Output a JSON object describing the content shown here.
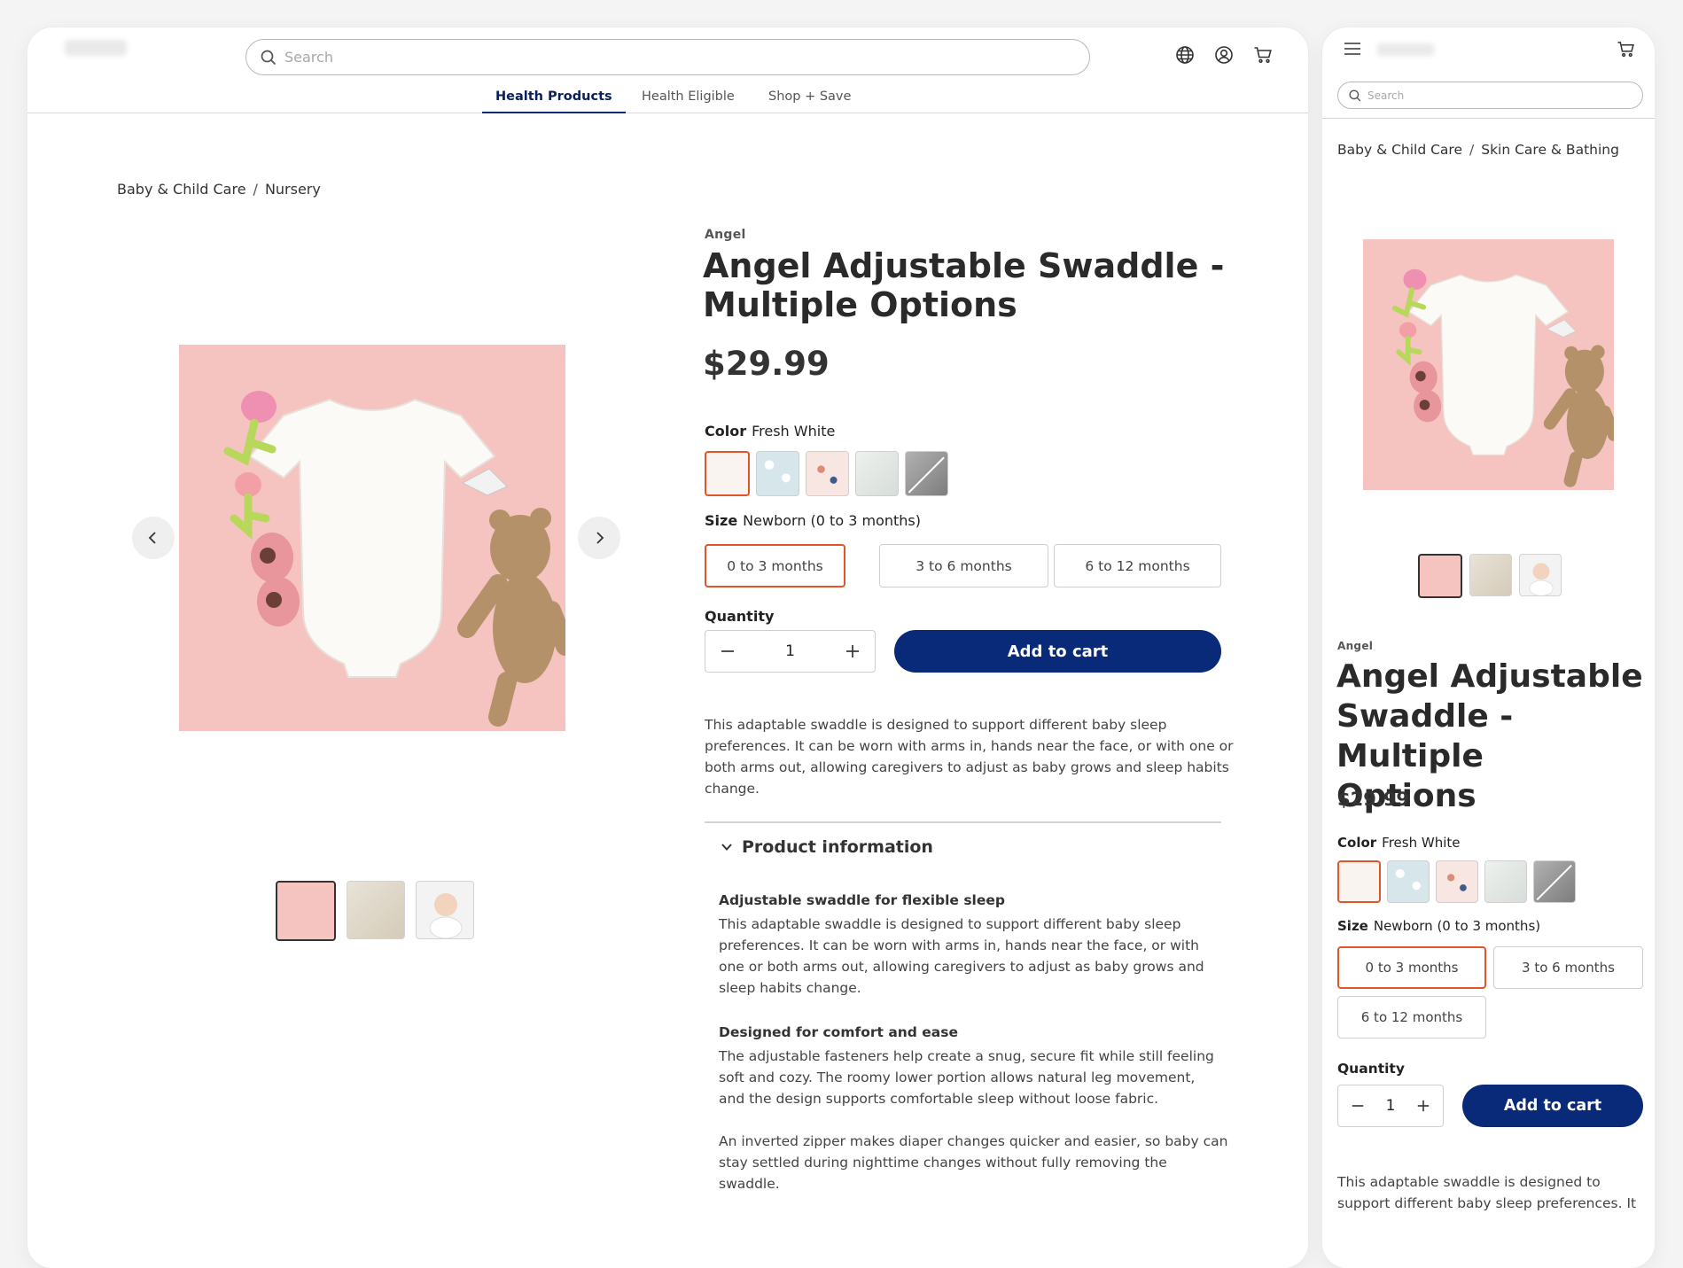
{
  "desktop": {
    "search_placeholder": "Search",
    "nav_tabs": [
      "Health Products",
      "Health Eligible",
      "Shop + Save"
    ],
    "breadcrumb": [
      "Baby & Child Care",
      "Nursery"
    ],
    "brand": "Angel",
    "title_line1": "Angel Adjustable Swaddle -",
    "title_line2": "Multiple Options",
    "price": "$29.99",
    "color_label": "Color",
    "color_value": "Fresh White",
    "size_label": "Size",
    "size_value": "Newborn (0 to 3 months)",
    "sizes": [
      "0 to 3 months",
      "3 to 6 months",
      "6 to 12 months"
    ],
    "quantity_label": "Quantity",
    "quantity": "1",
    "add_to_cart": "Add to cart",
    "description_lines": [
      "This adaptable swaddle is designed to support different baby sleep",
      "preferences. It can be worn with arms in, hands near the face, or with one or",
      "both arms out, allowing caregivers to adjust as baby grows and sleep habits",
      "change."
    ],
    "accordion_title": "Product information",
    "section1_heading": "Adjustable swaddle for flexible sleep",
    "section1_lines": [
      "This adaptable swaddle is designed to support different baby sleep",
      "preferences. It can be worn with arms in, hands near the face, or with",
      "one or both arms out, allowing caregivers to adjust as baby grows and",
      "sleep habits change."
    ],
    "section2_heading": "Designed for comfort and ease",
    "section2_lines": [
      "The adjustable fasteners help create a snug, secure fit while still feeling",
      "soft and cozy. The roomy lower portion allows natural leg movement,",
      "and the design supports comfortable sleep without loose fabric."
    ],
    "section3_lines": [
      "An inverted zipper makes diaper changes quicker and easier, so baby can",
      "stay settled during nighttime changes without fully removing the",
      "swaddle."
    ]
  },
  "mobile": {
    "search_placeholder": "Search",
    "breadcrumb": [
      "Baby & Child Care",
      "Skin Care & Bathing"
    ],
    "brand": "Angel",
    "title_line1": "Angel Adjustable",
    "title_line2": "Swaddle - Multiple",
    "title_line3": "Options",
    "price": "$29.99",
    "color_label": "Color",
    "color_value": "Fresh White",
    "size_label": "Size",
    "size_value": "Newborn (0 to 3 months)",
    "sizes": [
      "0 to 3 months",
      "3 to 6 months",
      "6 to 12 months"
    ],
    "quantity_label": "Quantity",
    "quantity": "1",
    "add_to_cart": "Add to cart",
    "description_lines": [
      "This adaptable swaddle is designed to",
      "support different baby sleep preferences. It"
    ]
  },
  "colors": {
    "accent_navy": "#082a78",
    "selected_orange": "#e2552a",
    "hero_pink": "#f6c4c0"
  },
  "icons": [
    "search-icon",
    "globe-icon",
    "account-icon",
    "cart-icon",
    "menu-icon",
    "chevron-left-icon",
    "chevron-right-icon",
    "chevron-down-icon",
    "minus-icon",
    "plus-icon"
  ]
}
